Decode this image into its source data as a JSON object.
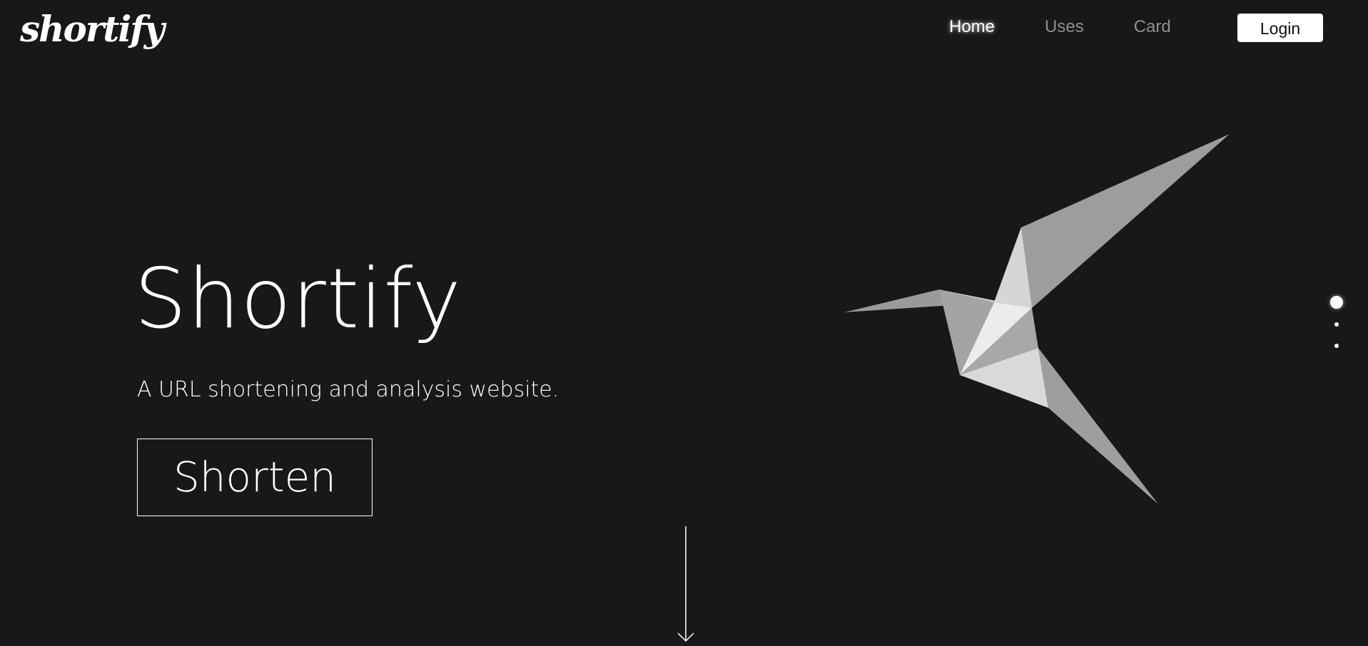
{
  "header": {
    "logo_text": "shortify",
    "nav": [
      {
        "label": "Home",
        "active": true
      },
      {
        "label": "Uses",
        "active": false
      },
      {
        "label": "Card",
        "active": false
      }
    ],
    "login_label": "Login"
  },
  "hero": {
    "title": "Shortify",
    "subtitle": "A URL shortening and analysis website.",
    "cta_label": "Shorten",
    "illustration": "origami-hummingbird",
    "scroll_icon": "arrow-down-icon"
  },
  "pagination": {
    "count": 3,
    "active_index": 0
  },
  "colors": {
    "background": "#181818",
    "text": "#ffffff",
    "nav_inactive": "#8f8f8f",
    "button_bg": "#ffffff",
    "button_text": "#111111"
  }
}
